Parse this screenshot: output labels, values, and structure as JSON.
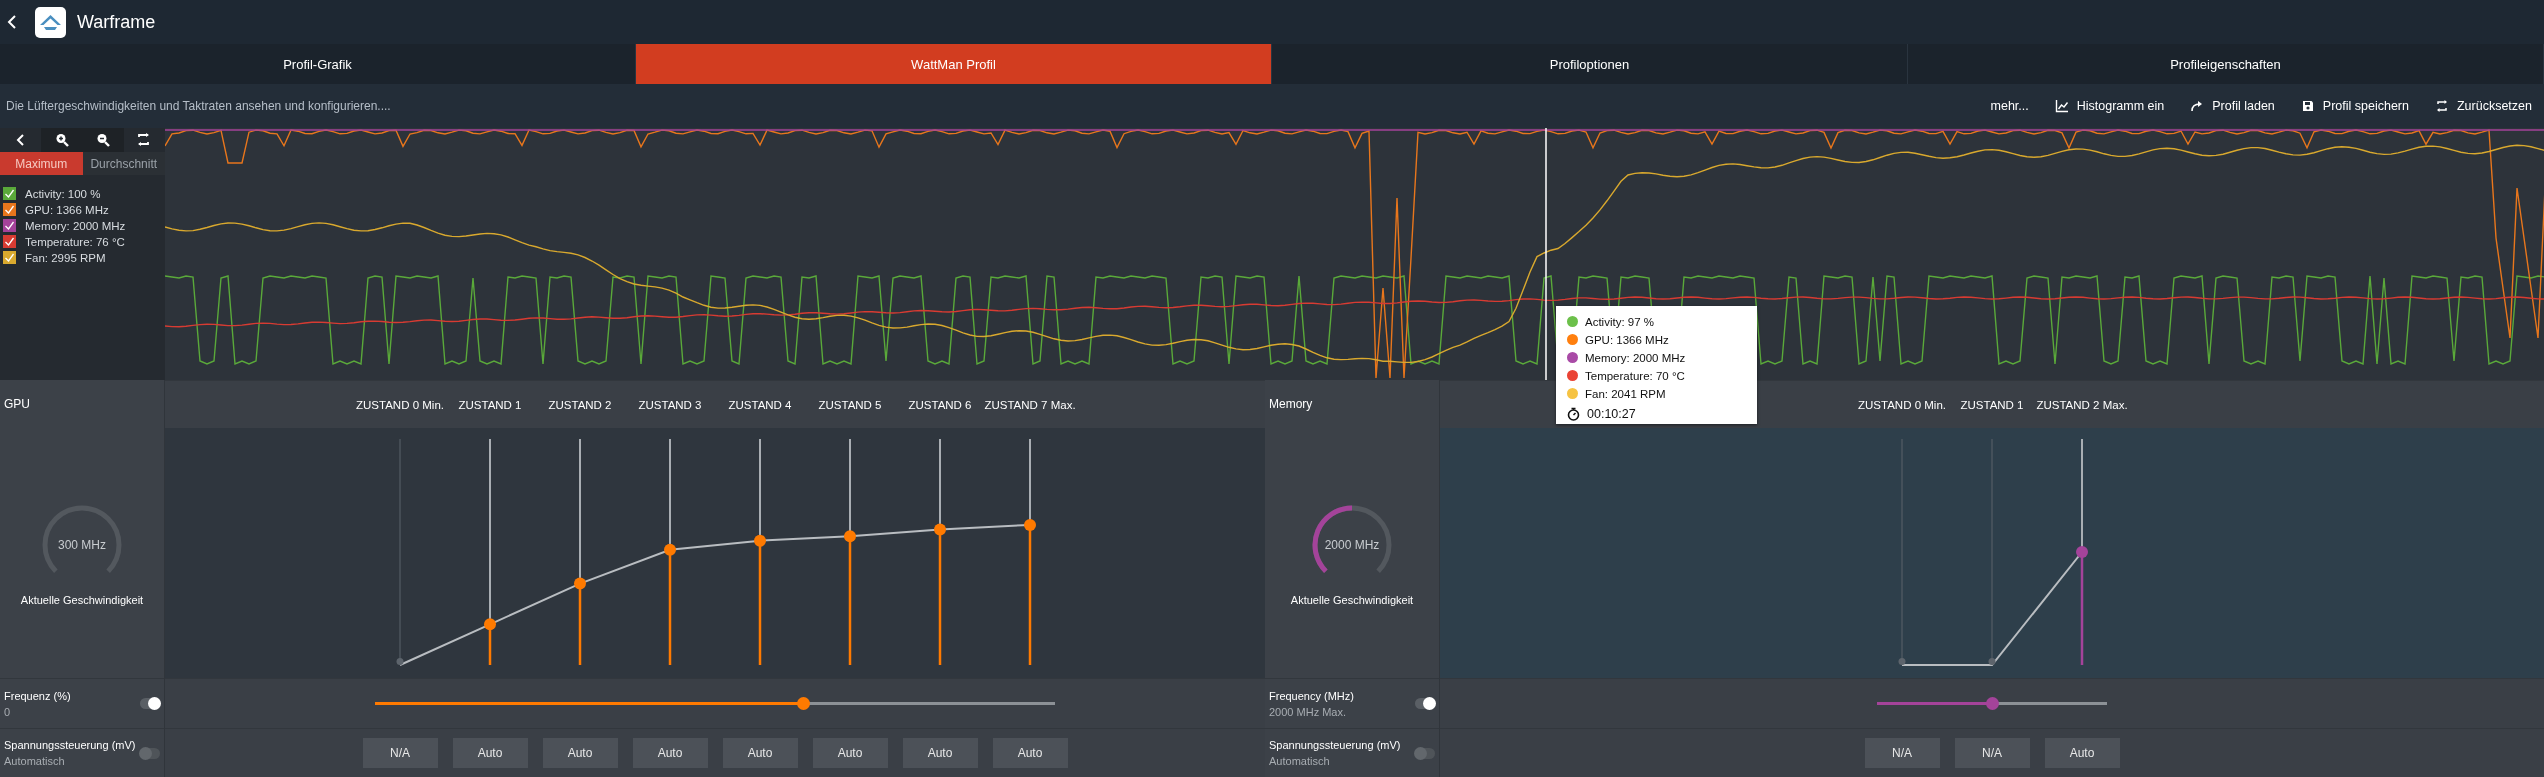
{
  "header": {
    "title": "Warframe"
  },
  "tabs": [
    {
      "label": "Profil-Grafik",
      "selected": false
    },
    {
      "label": "WattMan Profil",
      "selected": true
    },
    {
      "label": "Profiloptionen",
      "selected": false
    },
    {
      "label": "Profileigenschaften",
      "selected": false
    }
  ],
  "toolbar": {
    "description": "Die Lüftergeschwindigkeiten und Taktraten ansehen und konfigurieren....",
    "actions": [
      {
        "label": "mehr...",
        "kind": "text"
      },
      {
        "label": "Histogramm ein",
        "kind": "histogram"
      },
      {
        "label": "Profil laden",
        "kind": "load"
      },
      {
        "label": "Profil speichern",
        "kind": "save"
      },
      {
        "label": "Zurücksetzen",
        "kind": "reset"
      }
    ]
  },
  "monitor": {
    "modes": [
      {
        "label": "Maximum",
        "selected": true
      },
      {
        "label": "Durchschnitt",
        "selected": false
      }
    ],
    "legend": [
      {
        "label": "Activity: 100 %",
        "color": "#5aa93a",
        "checked": true
      },
      {
        "label": "GPU: 1366 MHz",
        "color": "#e8761c",
        "checked": true
      },
      {
        "label": "Memory: 2000 MHz",
        "color": "#a4439a",
        "checked": true
      },
      {
        "label": "Temperature: 76 °C",
        "color": "#d83b32",
        "checked": true
      },
      {
        "label": "Fan: 2995 RPM",
        "color": "#d9a92e",
        "checked": true
      }
    ],
    "tooltip": {
      "items": [
        {
          "label": "Activity: 97 %",
          "color": "#6cc04a"
        },
        {
          "label": "GPU: 1366 MHz",
          "color": "#ff7f0e"
        },
        {
          "label": "Memory: 2000 MHz",
          "color": "#a94aa6"
        },
        {
          "label": "Temperature: 70 °C",
          "color": "#ea4335"
        },
        {
          "label": "Fan: 2041 RPM",
          "color": "#f6c343"
        }
      ],
      "time": "00:10:27"
    }
  },
  "sections": [
    {
      "title": "GPU",
      "color": "#ff7a00",
      "gauge": {
        "reading": "300 MHz",
        "caption": "Aktuelle Geschwindigkeit"
      },
      "states": [
        {
          "label": "ZUSTAND 0 Min.",
          "level": 0,
          "enabled": false,
          "voltage": "N/A"
        },
        {
          "label": "ZUSTAND 1",
          "level": 0.18,
          "enabled": true,
          "voltage": "Auto"
        },
        {
          "label": "ZUSTAND 2",
          "level": 0.36,
          "enabled": true,
          "voltage": "Auto"
        },
        {
          "label": "ZUSTAND 3",
          "level": 0.51,
          "enabled": true,
          "voltage": "Auto"
        },
        {
          "label": "ZUSTAND 4",
          "level": 0.55,
          "enabled": true,
          "voltage": "Auto"
        },
        {
          "label": "ZUSTAND 5",
          "level": 0.57,
          "enabled": true,
          "voltage": "Auto"
        },
        {
          "label": "ZUSTAND 6",
          "level": 0.6,
          "enabled": true,
          "voltage": "Auto"
        },
        {
          "label": "ZUSTAND 7 Max.",
          "level": 0.62,
          "enabled": true,
          "voltage": "Auto"
        }
      ],
      "frequency": {
        "label": "Frequenz (%)",
        "value": "0",
        "on": true,
        "level": 0.63
      },
      "voltage_control": {
        "label": "Spannungssteuerung (mV)",
        "value": "Automatisch",
        "on": false
      }
    },
    {
      "title": "Memory",
      "color": "#a4439a",
      "gauge": {
        "reading": "2000 MHz",
        "caption": "Aktuelle Geschwindigkeit",
        "level": 0.5
      },
      "states": [
        {
          "label": "ZUSTAND 0 Min.",
          "level": 0,
          "enabled": false,
          "voltage": "N/A"
        },
        {
          "label": "ZUSTAND 1",
          "level": 0,
          "enabled": false,
          "voltage": "N/A"
        },
        {
          "label": "ZUSTAND 2 Max.",
          "level": 0.5,
          "enabled": true,
          "voltage": "Auto"
        }
      ],
      "frequency": {
        "label": "Frequency (MHz)",
        "value": "2000 MHz Max.",
        "on": true,
        "level": 0.5
      },
      "voltage_control": {
        "label": "Spannungssteuerung (mV)",
        "value": "Automatisch",
        "on": false
      }
    }
  ]
}
